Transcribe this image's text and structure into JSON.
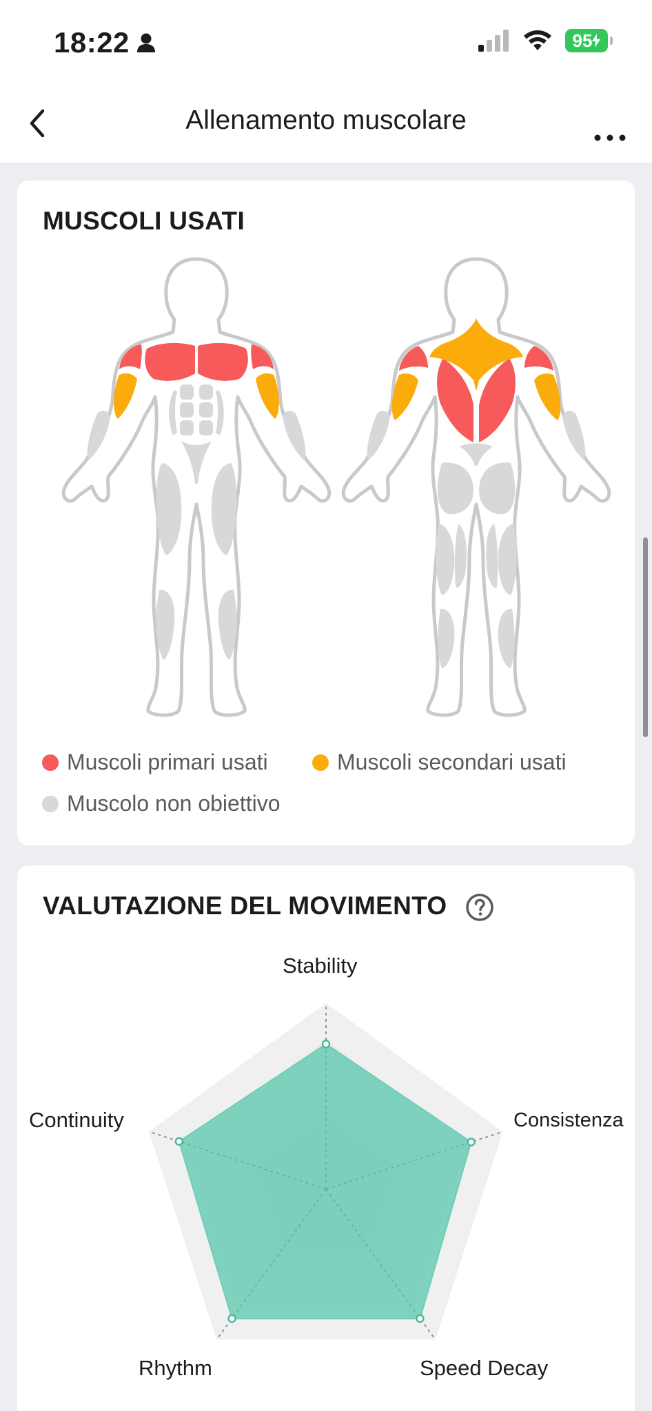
{
  "status_bar": {
    "time": "18:22",
    "battery": "95"
  },
  "nav": {
    "title": "Allenamento muscolare"
  },
  "muscles_card": {
    "title": "MUSCOLI USATI",
    "legend": {
      "primary": "Muscoli primari usati",
      "secondary": "Muscoli secondari usati",
      "non_target": "Muscolo non obiettivo"
    },
    "colors": {
      "primary": "#f65a5a",
      "secondary": "#fbab0a",
      "non_target": "#d8d8d8"
    }
  },
  "evaluation_card": {
    "title": "VALUTAZIONE DEL MOVIMENTO",
    "radar": {
      "axes": [
        "Stability",
        "Consistenza",
        "Speed Decay",
        "Rhythm",
        "Continuity"
      ],
      "values": [
        0.78,
        0.82,
        0.86,
        0.86,
        0.83
      ],
      "fill_color": "#6ecdb5"
    }
  }
}
